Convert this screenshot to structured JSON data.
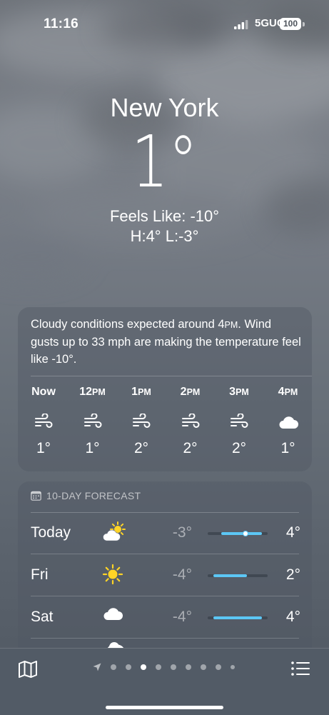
{
  "status": {
    "time": "11:16",
    "network": "5GUC",
    "battery": "100"
  },
  "location": {
    "city": "New York",
    "temp": "1°",
    "feels_like": "Feels Like: -10°",
    "high_low": "H:4°  L:-3°"
  },
  "hourly": {
    "summary_part1": "Cloudy conditions expected around 4",
    "summary_pm": "PM",
    "summary_part2": ". Wind gusts up to 33 mph are making the temperature feel like -10°.",
    "hours": [
      {
        "time": "Now",
        "suffix": "",
        "icon": "wind-icon",
        "temp": "1°"
      },
      {
        "time": "12",
        "suffix": "PM",
        "icon": "wind-icon",
        "temp": "1°"
      },
      {
        "time": "1",
        "suffix": "PM",
        "icon": "wind-icon",
        "temp": "2°"
      },
      {
        "time": "2",
        "suffix": "PM",
        "icon": "wind-icon",
        "temp": "2°"
      },
      {
        "time": "3",
        "suffix": "PM",
        "icon": "wind-icon",
        "temp": "2°"
      },
      {
        "time": "4",
        "suffix": "PM",
        "icon": "cloud-icon",
        "temp": "1°"
      }
    ]
  },
  "forecast": {
    "title": "10-DAY FORECAST",
    "temp_scale": [
      -4,
      4
    ],
    "days": [
      {
        "day": "Today",
        "icon": "partly-cloudy-icon",
        "low": "-3°",
        "high": "4°",
        "low_value": -3,
        "high_value": 4,
        "current_value": 1
      },
      {
        "day": "Fri",
        "icon": "sun-icon",
        "low": "-4°",
        "high": "2°",
        "low_value": -4,
        "high_value": 2
      },
      {
        "day": "Sat",
        "icon": "cloud-icon",
        "low": "-4°",
        "high": "4°",
        "low_value": -4,
        "high_value": 4
      }
    ]
  },
  "pager": {
    "page_count": 10,
    "current_index": 3
  },
  "colors": {
    "accent_blue": "#5cc7f5",
    "sun_yellow": "#ffd426"
  }
}
